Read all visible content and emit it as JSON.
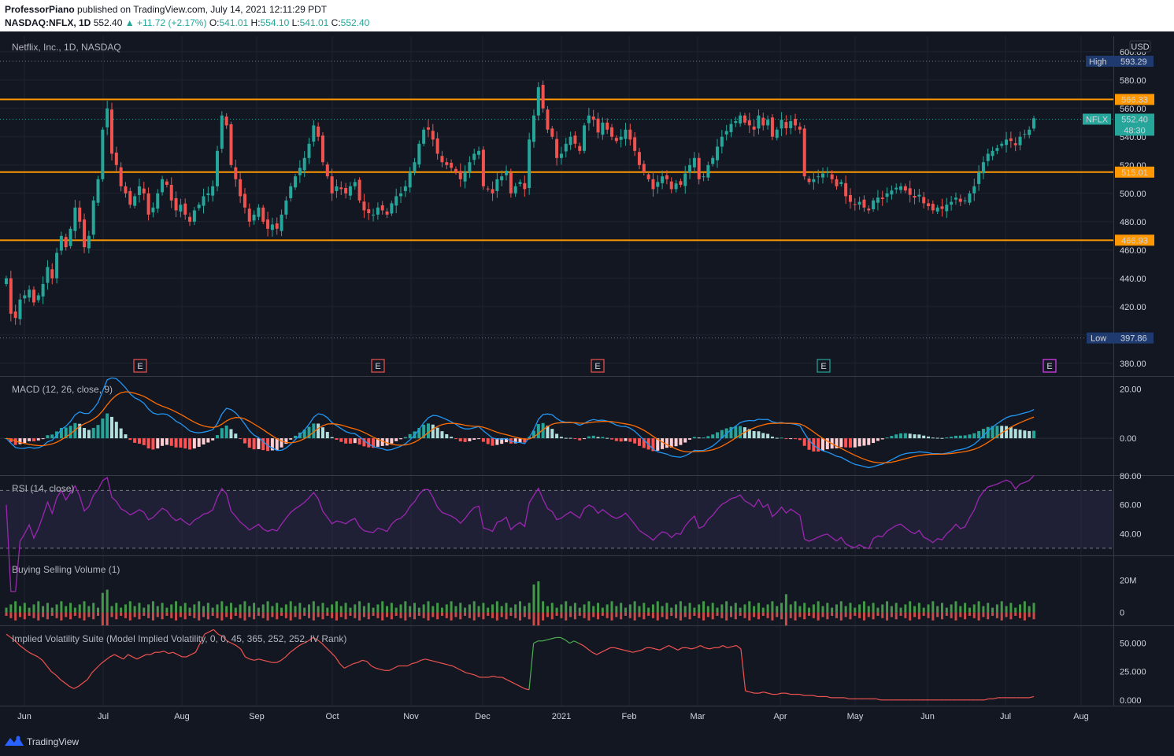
{
  "header": {
    "author": "ProfessorPiano",
    "published_text": "published on TradingView.com, July 14, 2021 12:11:29 PDT",
    "symbol": "NASDAQ:NFLX, 1D",
    "last": "552.40",
    "change": "+11.72 (+2.17%)",
    "o_label": "O:",
    "o": "541.01",
    "h_label": "H:",
    "h": "554.10",
    "l_label": "L:",
    "l": "541.01",
    "c_label": "C:",
    "c": "552.40"
  },
  "footer": {
    "brand": "TradingView"
  },
  "colors": {
    "background": "#131722",
    "up": "#26a69a",
    "down": "#ef5350",
    "level_line": "#ff9800",
    "macd": "#2196f3",
    "signal": "#ff6d00",
    "rsi": "#9c27b0",
    "iv": "#ef5350",
    "iv_high": "#4caf50"
  },
  "chart_data": [
    {
      "type": "candlestick",
      "title": "Netflix, Inc., 1D, NASDAQ",
      "currency": "USD",
      "x_labels": [
        "Jun",
        "Jul",
        "Aug",
        "Sep",
        "Oct",
        "Nov",
        "Dec",
        "2021",
        "Feb",
        "Mar",
        "Apr",
        "May",
        "Jun",
        "Jul",
        "Aug"
      ],
      "y_ticks": [
        "600.00",
        "580.00",
        "560.00",
        "540.00",
        "520.00",
        "500.00",
        "480.00",
        "460.00",
        "440.00",
        "420.00",
        "400.00",
        "380.00"
      ],
      "ylim": [
        371,
        611
      ],
      "levels": [
        "566.33",
        "515.01",
        "466.93"
      ],
      "high_label": "High",
      "high": "593.29",
      "low_label": "Low",
      "low": "397.86",
      "last_symbol": "NFLX",
      "last_price": "552.40",
      "countdown": "48:30",
      "earnings_marker": "E",
      "closes": [
        440,
        415,
        412,
        425,
        428,
        432,
        423,
        428,
        436,
        448,
        440,
        458,
        470,
        462,
        475,
        490,
        480,
        462,
        470,
        495,
        510,
        545,
        560,
        528,
        520,
        505,
        500,
        492,
        498,
        505,
        500,
        485,
        490,
        500,
        510,
        506,
        495,
        488,
        492,
        485,
        480,
        488,
        492,
        498,
        500,
        505,
        530,
        555,
        548,
        520,
        510,
        498,
        490,
        480,
        485,
        490,
        480,
        475,
        478,
        475,
        485,
        495,
        505,
        512,
        518,
        525,
        535,
        548,
        540,
        522,
        512,
        500,
        505,
        503,
        500,
        505,
        508,
        495,
        488,
        486,
        485,
        490,
        488,
        485,
        493,
        498,
        500,
        505,
        515,
        522,
        535,
        545,
        545,
        538,
        528,
        522,
        520,
        518,
        515,
        510,
        515,
        522,
        528,
        530,
        505,
        503,
        500,
        510,
        512,
        516,
        500,
        505,
        508,
        503,
        538,
        555,
        575,
        560,
        545,
        540,
        525,
        528,
        535,
        540,
        535,
        530,
        548,
        555,
        552,
        543,
        550,
        545,
        540,
        537,
        540,
        545,
        538,
        530,
        520,
        515,
        510,
        503,
        508,
        512,
        510,
        503,
        507,
        506,
        514,
        520,
        525,
        510,
        512,
        520,
        525,
        533,
        540,
        544,
        549,
        551,
        555,
        550,
        548,
        545,
        555,
        548,
        552,
        540,
        545,
        552,
        546,
        551,
        548,
        545,
        512,
        508,
        510,
        512,
        514,
        515,
        510,
        505,
        508,
        498,
        494,
        492,
        494,
        490,
        488,
        495,
        497,
        496,
        500,
        502,
        504,
        505,
        502,
        499,
        497,
        499,
        493,
        491,
        488,
        490,
        489,
        492,
        494,
        497,
        494,
        495,
        500,
        505,
        515,
        522,
        528,
        530,
        532,
        535,
        538,
        537,
        534,
        540,
        542,
        545,
        553
      ],
      "macd": {
        "title": "MACD (12, 26, close, 9)",
        "y_ticks": [
          "20.00",
          "0.00"
        ],
        "ylim": [
          -15,
          25
        ]
      },
      "rsi": {
        "title": "RSI (14, close)",
        "y_ticks": [
          "80.00",
          "60.00",
          "40.00"
        ],
        "ylim": [
          25,
          80
        ],
        "overbought": 70,
        "oversold": 30
      },
      "volume": {
        "title": "Buying Selling Volume (1)",
        "y_ticks": [
          "20M",
          "0"
        ],
        "ylim": [
          -8,
          35
        ]
      },
      "iv": {
        "title": "Implied Volatility Suite (Model Implied Volatility, 0, 0, 45, 365, 252, 252, IV Rank)",
        "y_ticks": [
          "50.000",
          "25.000",
          "0.000"
        ],
        "ylim": [
          -5,
          65
        ],
        "values": [
          58,
          55,
          52,
          48,
          45,
          42,
          40,
          38,
          35,
          30,
          25,
          22,
          18,
          15,
          12,
          10,
          12,
          15,
          18,
          24,
          28,
          32,
          35,
          38,
          40,
          38,
          36,
          40,
          38,
          36,
          38,
          40,
          40,
          42,
          42,
          43,
          41,
          42,
          40,
          38,
          38,
          40,
          42,
          50,
          58,
          60,
          62,
          58,
          56,
          52,
          50,
          48,
          45,
          38,
          36,
          35,
          36,
          35,
          34,
          33,
          33,
          35,
          38,
          42,
          45,
          48,
          50,
          52,
          55,
          53,
          50,
          46,
          42,
          38,
          32,
          28,
          30,
          32,
          33,
          35,
          34,
          30,
          28,
          27,
          26,
          26,
          28,
          30,
          30,
          30,
          32,
          33,
          35,
          36,
          35,
          34,
          33,
          32,
          31,
          30,
          28,
          26,
          24,
          23,
          22,
          20,
          20,
          20,
          21,
          20,
          20,
          18,
          16,
          14,
          12,
          10,
          9,
          50,
          52,
          52,
          53,
          54,
          55,
          55,
          53,
          50,
          52,
          50,
          48,
          45,
          42,
          40,
          42,
          44,
          46,
          46,
          45,
          44,
          43,
          42,
          43,
          44,
          46,
          46,
          45,
          44,
          46,
          48,
          46,
          44,
          46,
          46,
          45,
          46,
          48,
          46,
          45,
          46,
          46,
          48,
          46,
          47,
          48,
          45,
          8,
          7,
          6,
          6,
          7,
          6,
          5,
          5,
          6,
          6,
          5,
          5,
          5,
          4,
          4,
          4,
          3,
          3,
          3,
          2,
          2,
          2,
          2,
          1,
          1,
          1,
          1,
          1,
          1,
          1,
          0,
          0,
          0,
          0,
          0,
          0,
          0,
          0,
          0,
          0,
          0,
          0,
          0,
          0,
          0,
          0,
          0,
          0,
          0,
          0,
          0,
          0,
          0,
          0,
          1,
          1,
          2,
          2,
          2,
          2,
          2,
          2,
          2,
          2,
          3
        ]
      }
    }
  ]
}
